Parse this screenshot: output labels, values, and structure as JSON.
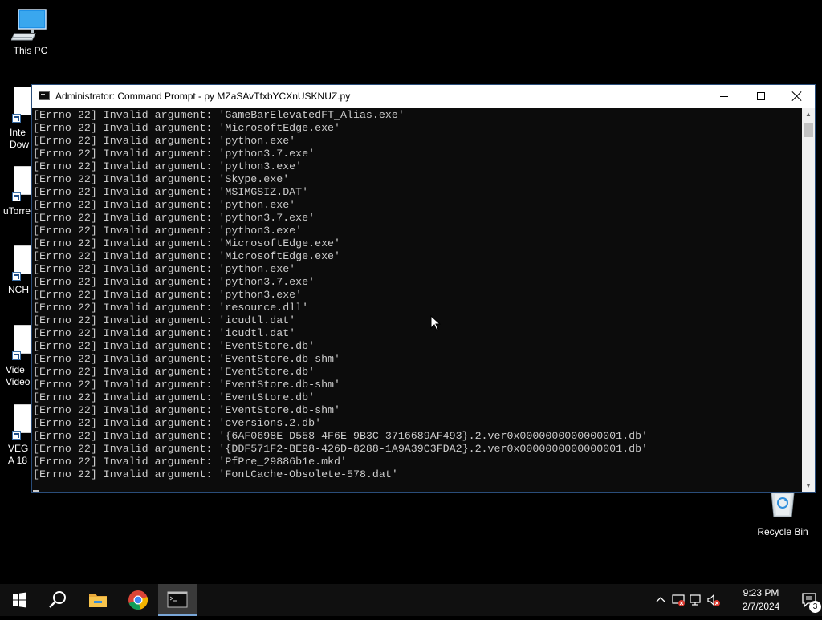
{
  "desktop": {
    "icons": [
      {
        "label": "This PC",
        "icon": "this-pc-icon"
      },
      {
        "label": "Inte Dow",
        "icon": "internet-download-manager-icon"
      },
      {
        "label": "uTorre",
        "icon": "utorrent-icon"
      },
      {
        "label": "NCH",
        "icon": "nch-icon"
      },
      {
        "label": "Vide Video",
        "icon": "video-icon"
      },
      {
        "label": "VEGA 18",
        "icon": "vegas-icon"
      },
      {
        "label": "Recycle Bin",
        "icon": "recycle-bin-icon"
      }
    ]
  },
  "window": {
    "title": "Administrator: Command Prompt - py  MZaSAvTfxbYCXnUSKNUZ.py",
    "controls": {
      "minimize": "minimize-icon",
      "maximize": "maximize-icon",
      "close": "close-icon"
    }
  },
  "console": {
    "lines": [
      "[Errno 22] Invalid argument: 'GameBarElevatedFT_Alias.exe'",
      "[Errno 22] Invalid argument: 'MicrosoftEdge.exe'",
      "[Errno 22] Invalid argument: 'python.exe'",
      "[Errno 22] Invalid argument: 'python3.7.exe'",
      "[Errno 22] Invalid argument: 'python3.exe'",
      "[Errno 22] Invalid argument: 'Skype.exe'",
      "[Errno 22] Invalid argument: 'MSIMGSIZ.DAT'",
      "[Errno 22] Invalid argument: 'python.exe'",
      "[Errno 22] Invalid argument: 'python3.7.exe'",
      "[Errno 22] Invalid argument: 'python3.exe'",
      "[Errno 22] Invalid argument: 'MicrosoftEdge.exe'",
      "[Errno 22] Invalid argument: 'MicrosoftEdge.exe'",
      "[Errno 22] Invalid argument: 'python.exe'",
      "[Errno 22] Invalid argument: 'python3.7.exe'",
      "[Errno 22] Invalid argument: 'python3.exe'",
      "[Errno 22] Invalid argument: 'resource.dll'",
      "[Errno 22] Invalid argument: 'icudtl.dat'",
      "[Errno 22] Invalid argument: 'icudtl.dat'",
      "[Errno 22] Invalid argument: 'EventStore.db'",
      "[Errno 22] Invalid argument: 'EventStore.db-shm'",
      "[Errno 22] Invalid argument: 'EventStore.db'",
      "[Errno 22] Invalid argument: 'EventStore.db-shm'",
      "[Errno 22] Invalid argument: 'EventStore.db'",
      "[Errno 22] Invalid argument: 'EventStore.db-shm'",
      "[Errno 22] Invalid argument: 'cversions.2.db'",
      "[Errno 22] Invalid argument: '{6AF0698E-D558-4F6E-9B3C-3716689AF493}.2.ver0x0000000000000001.db'",
      "[Errno 22] Invalid argument: '{DDF571F2-BE98-426D-8288-1A9A39C3FDA2}.2.ver0x0000000000000001.db'",
      "[Errno 22] Invalid argument: 'PfPre_29886b1e.mkd'",
      "[Errno 22] Invalid argument: 'FontCache-Obsolete-578.dat'"
    ]
  },
  "taskbar": {
    "apps": [
      {
        "name": "start",
        "icon": "windows-start-icon"
      },
      {
        "name": "search",
        "icon": "search-icon"
      },
      {
        "name": "file-explorer",
        "icon": "file-explorer-icon"
      },
      {
        "name": "chrome",
        "icon": "chrome-icon"
      },
      {
        "name": "command-prompt",
        "icon": "command-prompt-icon",
        "active": true
      }
    ],
    "tray": {
      "time": "9:23 PM",
      "date": "2/7/2024",
      "notification_count": "3"
    }
  },
  "colors": {
    "console_bg": "#0c0c0c",
    "console_fg": "#cccccc",
    "taskbar_bg": "#101010",
    "active_accent": "#7aa7d8"
  }
}
